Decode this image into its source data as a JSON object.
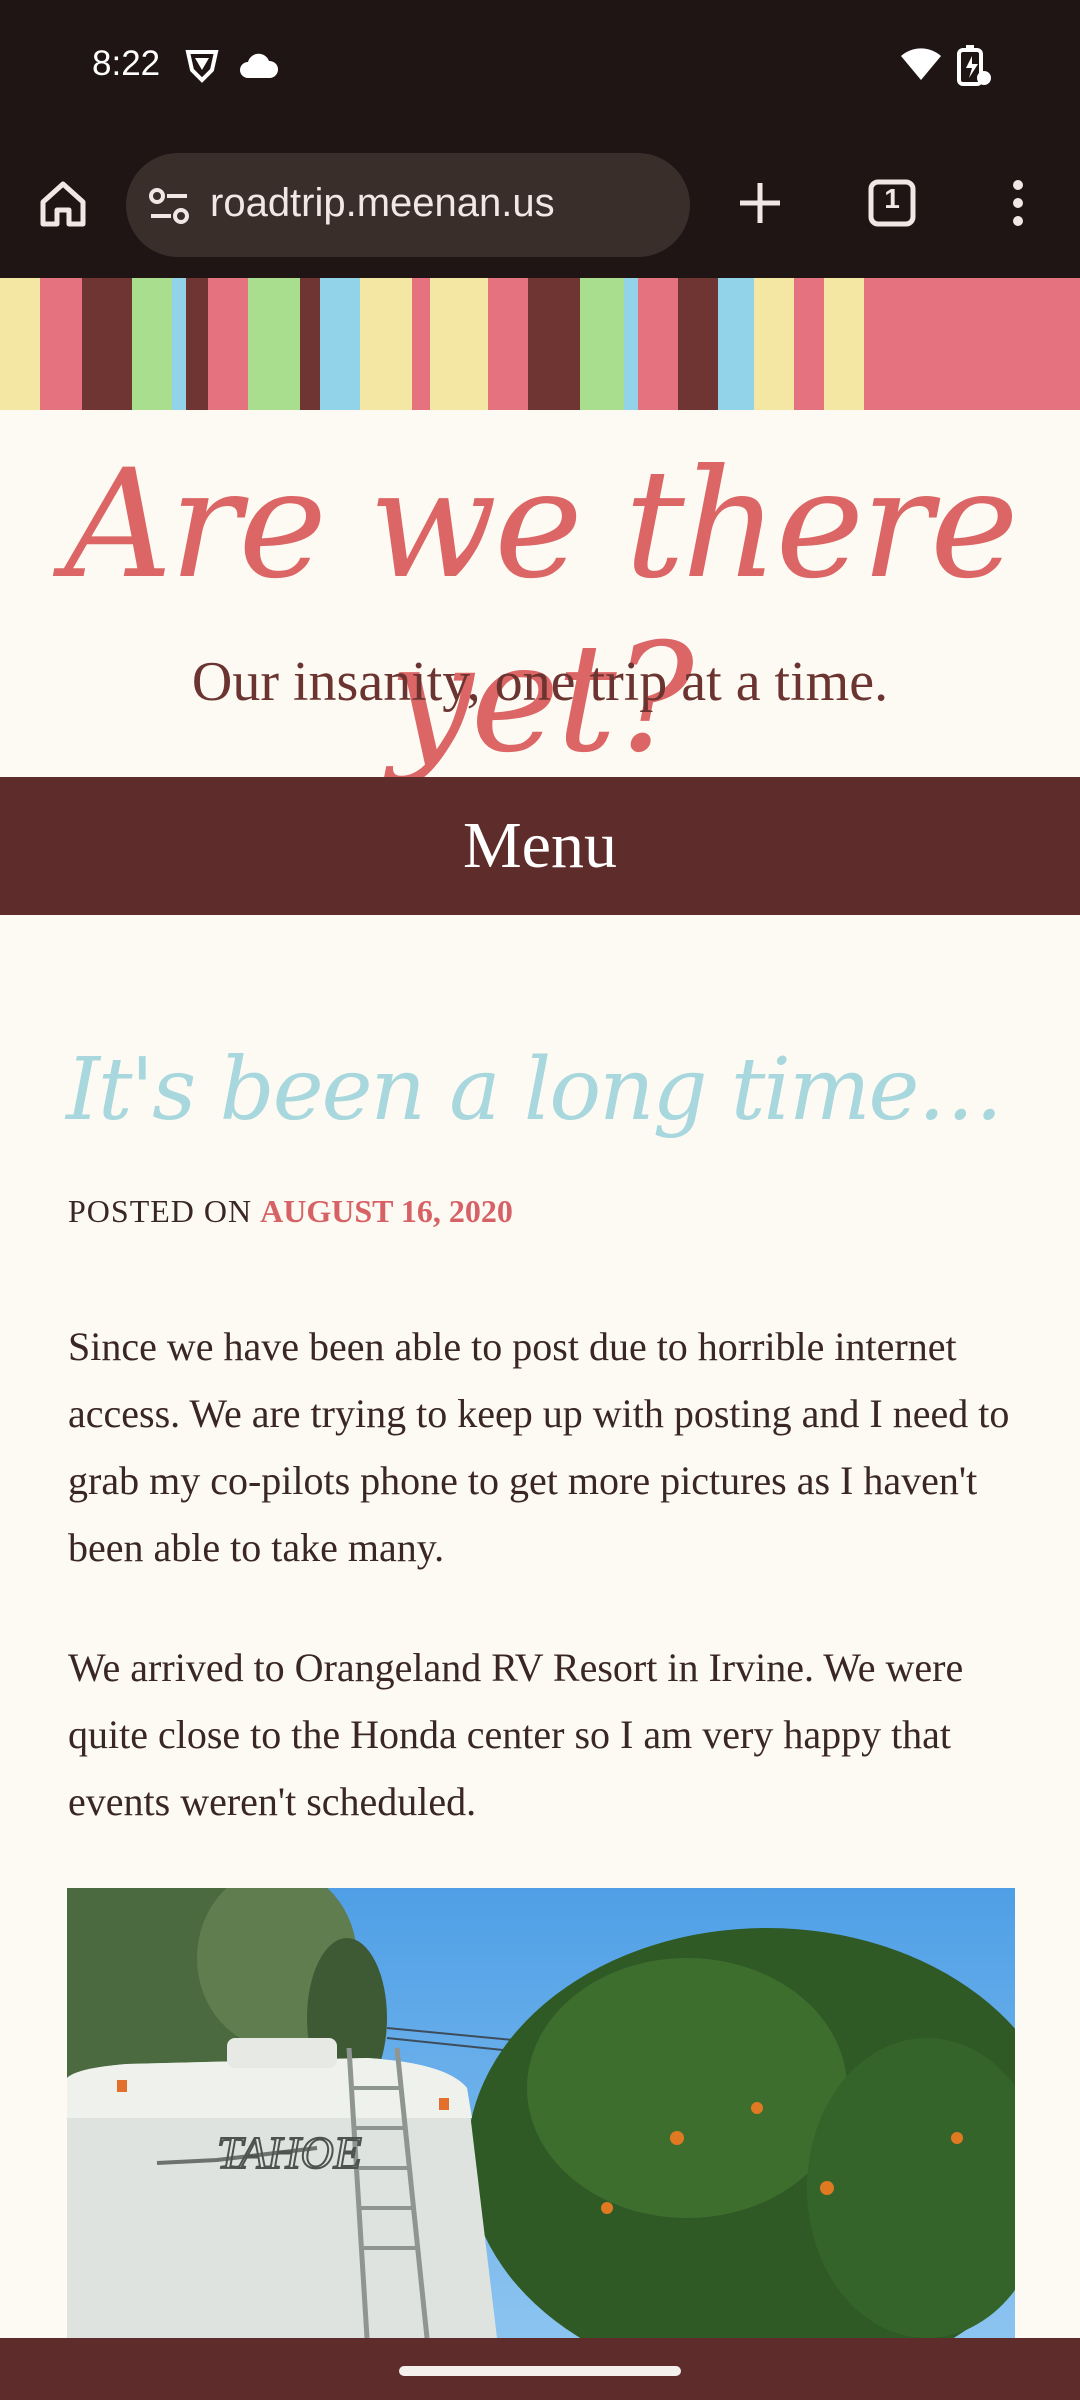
{
  "status_bar": {
    "time": "8:22",
    "icons": [
      "vpn-shield-icon",
      "cloud-icon",
      "wifi-icon",
      "battery-icon"
    ]
  },
  "browser": {
    "url": "roadtrip.meenan.us",
    "tab_count": "1",
    "icons": [
      "home-icon",
      "site-settings-icon",
      "new-tab-icon",
      "tab-switcher-icon",
      "more-options-icon"
    ]
  },
  "banner": {
    "stripe_colors": [
      "#f3e7a3",
      "#e5737f",
      "#6e3532",
      "#a8de8d",
      "#93d3ea",
      "#6e3532",
      "#e5737f",
      "#a8de8d",
      "#6e3532",
      "#93d3ea",
      "#f3e7a3",
      "#e5737f",
      "#f3e7a3",
      "#e5737f",
      "#6e3532",
      "#a8de8d",
      "#93d3ea",
      "#e5737f",
      "#6e3532",
      "#93d3ea",
      "#f3e7a3",
      "#e5737f",
      "#f3e7a3",
      "#e5737f"
    ]
  },
  "site": {
    "title": "Are we there yet?",
    "tagline": "Our insanity, one trip at a time.",
    "menu_label": "Menu"
  },
  "post": {
    "title": "It's been a long time…",
    "posted_on": "POSTED ON",
    "date": "AUGUST 16, 2020",
    "paragraphs": [
      "Since we have been able to post due to horrible internet access. We are trying to keep up with posting and I need to grab my co-pilots phone to get more pictures as I haven't been able to take many.",
      "We arrived to Orangeland RV Resort in Irvine. We were quite close to the Honda center so I am very happy that events weren't scheduled."
    ],
    "photo_caption_text": "TAHOE"
  },
  "colors": {
    "brand_dark": "#5e2c2a",
    "title_pink": "#dc6566",
    "post_title_blue": "#a8d7dd",
    "background": "#fcfaf2"
  }
}
